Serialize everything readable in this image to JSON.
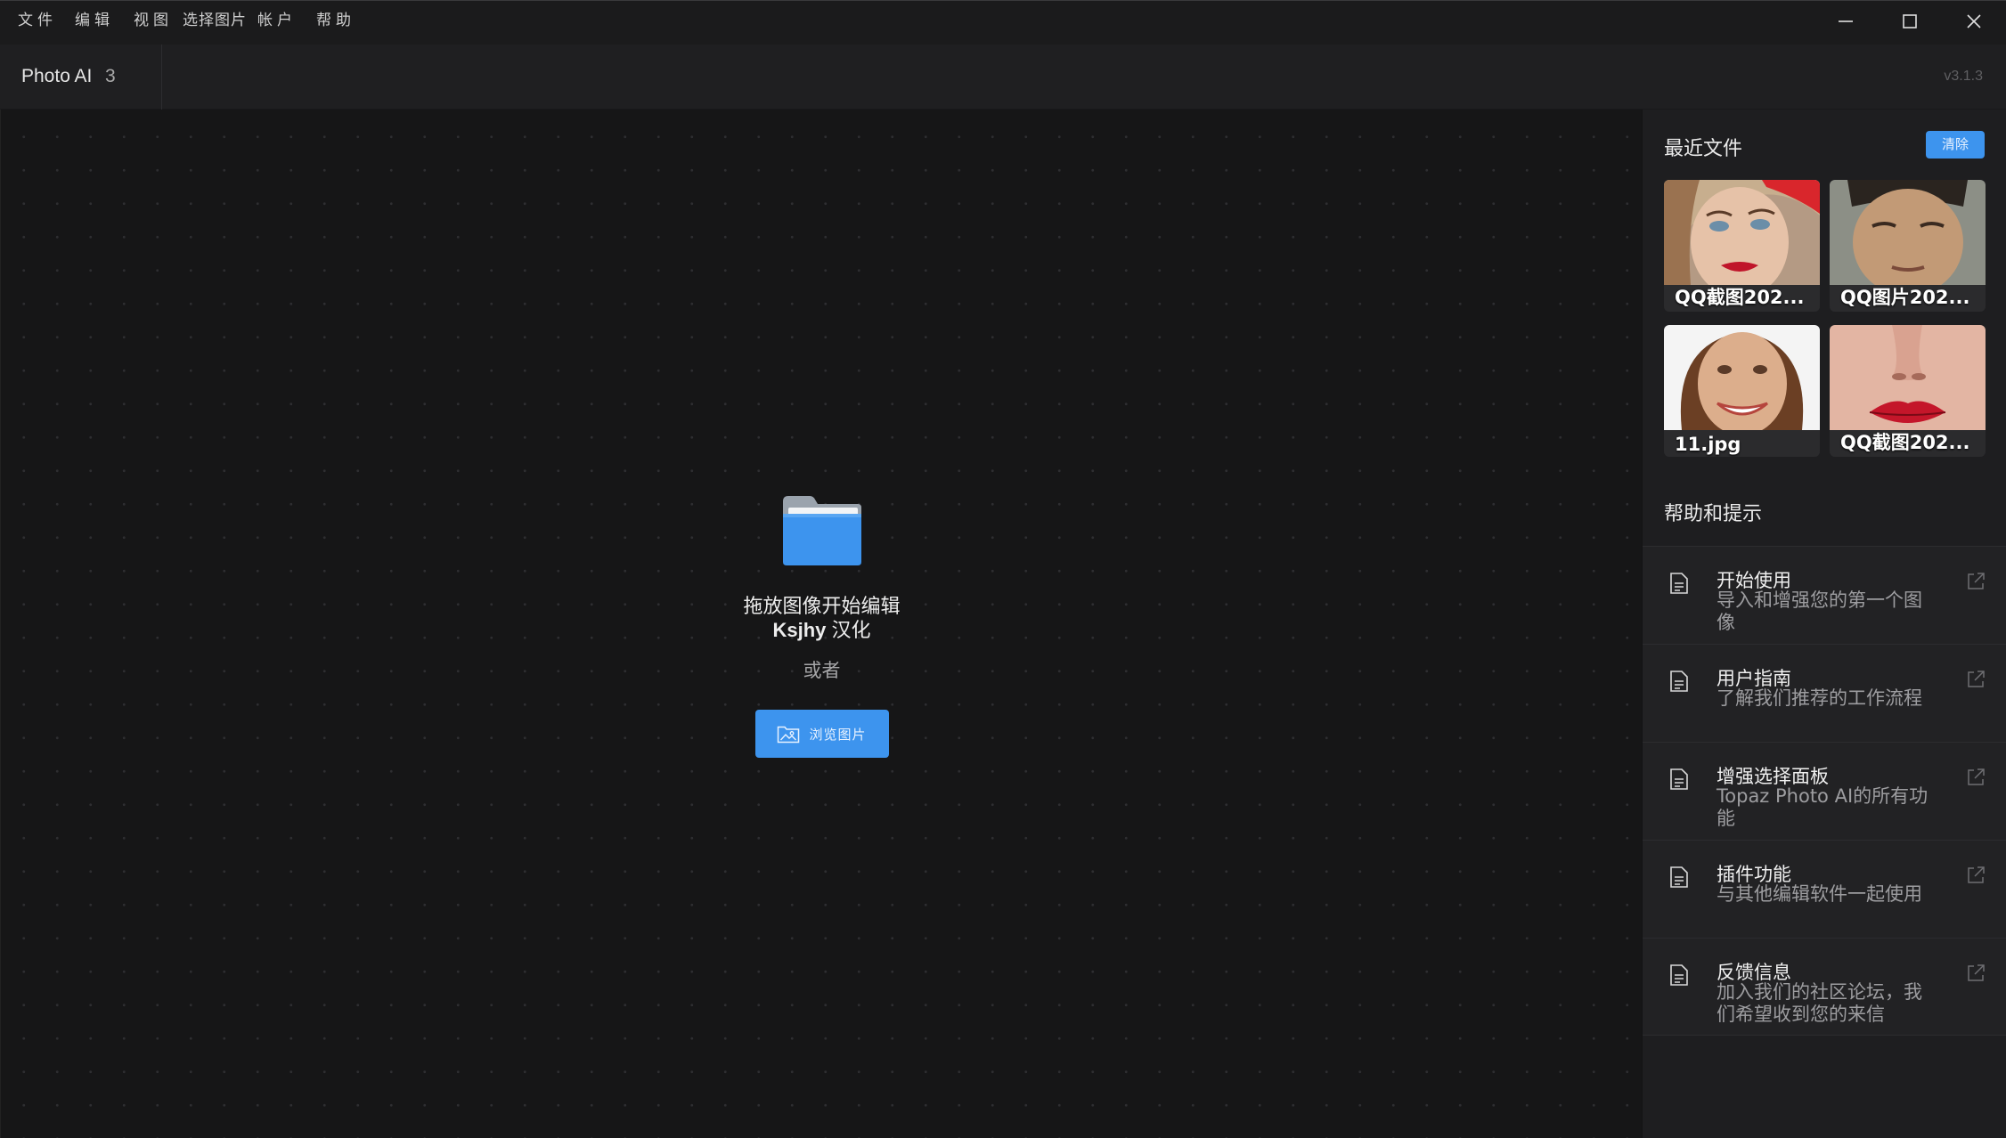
{
  "menubar": {
    "items": [
      "文件",
      "编辑",
      "视图",
      "选择图片",
      "帐户",
      "帮助"
    ],
    "window_controls": [
      "minimize-icon",
      "maximize-icon",
      "close-icon"
    ]
  },
  "header": {
    "app_name": "Photo AI",
    "app_major": "3",
    "version": "v3.1.3"
  },
  "main": {
    "folder_icon": "folder-icon",
    "drop_title": "拖放图像开始编辑",
    "drop_credit_bold": "Ksjhy",
    "drop_credit_rest": " 汉化",
    "or_text": "或者",
    "browse_label": "浏览图片"
  },
  "sidebar": {
    "recent_title": "最近文件",
    "clear_label": "清除",
    "recent_files": [
      {
        "name": "QQ截图202..."
      },
      {
        "name": "QQ图片202..."
      },
      {
        "name": "11.jpg"
      },
      {
        "name": "QQ截图202..."
      }
    ],
    "help_title": "帮助和提示",
    "help_items": [
      {
        "title": "开始使用",
        "desc": "导入和增强您的第一个图像"
      },
      {
        "title": "用户指南",
        "desc": "了解我们推荐的工作流程"
      },
      {
        "title": "增强选择面板",
        "desc": "Topaz Photo AI的所有功能"
      },
      {
        "title": "插件功能",
        "desc": "与其他编辑软件一起使用"
      },
      {
        "title": "反馈信息",
        "desc": "加入我们的社区论坛，我们希望收到您的来信"
      }
    ]
  },
  "colors": {
    "accent": "#3d94ee",
    "background": "#161617",
    "sidebar": "#1e1e20"
  }
}
